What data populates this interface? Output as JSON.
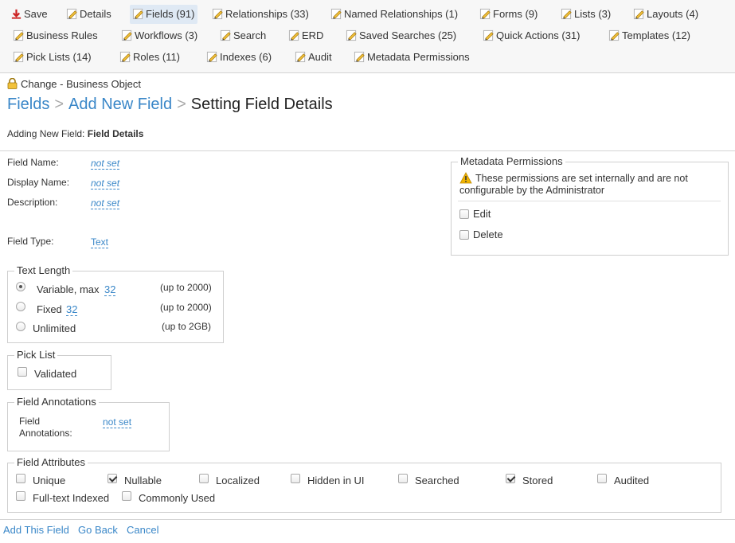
{
  "toolbar": {
    "save": "Save",
    "details": "Details",
    "fields": "Fields (91)",
    "relationships": "Relationships (33)",
    "named_relationships": "Named Relationships (1)",
    "forms": "Forms (9)",
    "lists": "Lists (3)",
    "layouts": "Layouts (4)",
    "business_rules": "Business Rules",
    "workflows": "Workflows (3)",
    "search": "Search",
    "erd": "ERD",
    "saved_searches": "Saved Searches (25)",
    "quick_actions": "Quick Actions (31)",
    "templates": "Templates (12)",
    "pick_lists": "Pick Lists (14)",
    "roles": "Roles (11)",
    "indexes": "Indexes (6)",
    "audit": "Audit",
    "metadata_permissions": "Metadata Permissions"
  },
  "header": {
    "object_label": "Change - Business Object",
    "breadcrumb": {
      "fields": "Fields",
      "add_new_field": "Add New Field",
      "current": "Setting Field Details"
    },
    "subtitle_prefix": "Adding New Field:",
    "subtitle_bold": "Field Details"
  },
  "form": {
    "field_name_label": "Field Name:",
    "field_name_value": "not set",
    "display_name_label": "Display Name:",
    "display_name_value": "not set",
    "description_label": "Description:",
    "description_value": "not set",
    "field_type_label": "Field Type:",
    "field_type_value": "Text"
  },
  "text_length": {
    "legend": "Text Length",
    "variable_label": "Variable, max",
    "variable_value": "32",
    "variable_hint": "(up to 2000)",
    "fixed_label": "Fixed",
    "fixed_value": "32",
    "fixed_hint": "(up to 2000)",
    "unlimited_label": "Unlimited",
    "unlimited_hint": "(up to 2GB)",
    "selected": "variable"
  },
  "pick_list": {
    "legend": "Pick List",
    "validated_label": "Validated",
    "validated": false
  },
  "annotations": {
    "legend": "Field Annotations",
    "label_line1": "Field",
    "label_line2": "Annotations:",
    "value": "not set"
  },
  "attributes": {
    "legend": "Field Attributes",
    "unique": "Unique",
    "nullable": "Nullable",
    "localized": "Localized",
    "hidden_in_ui": "Hidden in UI",
    "searched": "Searched",
    "stored": "Stored",
    "audited": "Audited",
    "full_text_indexed": "Full-text Indexed",
    "commonly_used": "Commonly Used",
    "checked": [
      "nullable",
      "stored"
    ]
  },
  "metadata": {
    "legend": "Metadata Permissions",
    "warning_line1": "These permissions are set internally and are not",
    "warning_line2": "configurable by the Administrator",
    "edit_label": "Edit",
    "delete_label": "Delete"
  },
  "footer": {
    "add": "Add This Field",
    "back": "Go Back",
    "cancel": "Cancel"
  },
  "colors": {
    "link": "#3a87c8",
    "toolbar_bg": "#f7f7f7",
    "active_tab_bg": "#dfe9f4",
    "save_icon": "#cc2222",
    "warning": "#f0b400"
  }
}
